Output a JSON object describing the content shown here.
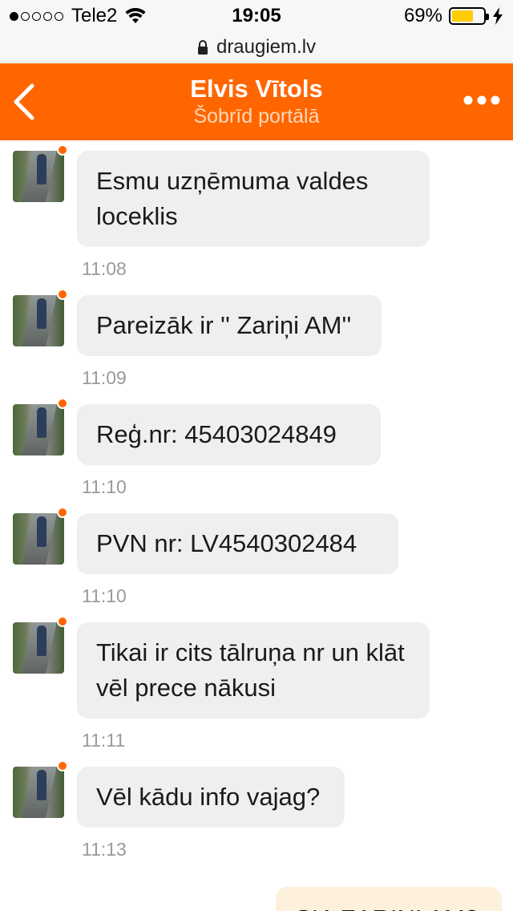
{
  "status_bar": {
    "signal_dots_filled": 1,
    "signal_dots_total": 5,
    "carrier": "Tele2",
    "time": "19:05",
    "battery_percent": "69%",
    "battery_level": 0.69,
    "battery_color": "#ffcc00"
  },
  "url_bar": {
    "url": "draugiem.lv"
  },
  "header": {
    "contact_name": "Elvis Vītols",
    "presence": "Šobrīd portālā",
    "accent_color": "#ff6600"
  },
  "messages": [
    {
      "text": "Esmu uzņēmuma valdes loceklis",
      "time": "11:08"
    },
    {
      "text": "Pareizāk ir '' Zariņi AM''",
      "time": "11:09"
    },
    {
      "text": "Reģ.nr: 45403024849",
      "time": "11:10"
    },
    {
      "text": "PVN nr: LV4540302484",
      "time": "11:10"
    },
    {
      "text": "Tikai ir cits tālruņa nr un klāt vēl prece nākusi",
      "time": "11:11"
    },
    {
      "text": "Vēl kādu info vajag?",
      "time": "11:13"
    }
  ],
  "outgoing_message": {
    "text": "SIA ZARIŅI AM?"
  }
}
